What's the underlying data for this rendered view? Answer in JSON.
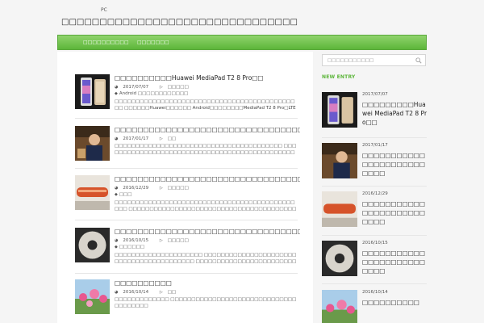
{
  "header": {
    "tagline": "PC",
    "site_title": "□□□□□□□□□□□□□□□□□□□□□□□□□□□□□□□"
  },
  "nav": {
    "items": [
      "□□□□□□□□□□",
      "□□□□□□□"
    ]
  },
  "posts": [
    {
      "title": "□□□□□□□□□□Huawei MediaPad T2 8 Pro□□",
      "date": "2017/07/07",
      "category": "□□□□□",
      "tags": "Android □□□□□□□□□□□□",
      "excerpt": "□□□□□□□□□□□□□□□□□□□□□□□□□□□□□□□□□□□□□□□□□□□□□ □□□□□□Huawei□□□□□□ Android□□□□□□□□MediaPad T2 8 Pro□LTE□□ ..."
    },
    {
      "title": "□□□□□□□□□□□□□□□□□□□□□□□□□□□□□□□□□",
      "date": "2017/01/17",
      "category": "□□",
      "tags": "",
      "excerpt": "□□□□□□□□□□□□□□□□□□□□□□□□□□□□□□□□□□□□□□□□ □□□□□□□□□□□□□□□□□□□□□□□□□□□□□□□□□□□□□□□□□□□□□□□□□□□□ ..."
    },
    {
      "title": "□□□□□□□□□□□□□□□□□□□□□□□□□□□□□□□□□",
      "date": "2016/12/29",
      "category": "□□□□□",
      "tags": "□□□",
      "excerpt": "□□□□□□□□□□□□□□□□□□□□□□□□□□□□□□□□□□□□□□□□□□□□□□ □□□□□□□□□□□□□□□□□□□□□□□□□□□□□□□□□□□□□□□□□□□□□□□□□ □ ..."
    },
    {
      "title": "□□□□□□□□□□□□□□□□□□□□□□□□□□□□□□□□□",
      "date": "2016/10/15",
      "category": "□□□□□",
      "tags": "□□□□□□",
      "excerpt": "□□□□□□□□□□□□□□□□□□□□□ □□□□□□□□□□□□□□□□□□□□□□□□□□□□□□□□□□□□□□□□□ □□□□□□□□□□□□□□□□□□□□□□□□□□□□□□□□□□□□□□ ..."
    },
    {
      "title": "□□□□□□□□□□",
      "date": "2016/10/14",
      "category": "□□",
      "tags": "",
      "excerpt": "□□□□□□□□□□□□□ □□□□□□□□□□□□□□□□□□□□□□□□□□□□□□□□□□□□□□"
    }
  ],
  "sidebar": {
    "search_placeholder": "□□□□□□□□□□□",
    "heading": "NEW ENTRY",
    "entries": [
      {
        "date": "2017/07/07",
        "title": "□□□□□□□□□Huawei MediaPad T2 8 Pro□□"
      },
      {
        "date": "2017/01/17",
        "title": "□□□□□□□□□□□□□□□□□□□□□□□□□□"
      },
      {
        "date": "2016/12/29",
        "title": "□□□□□□□□□□□□□□□□□□□□□□□□□□"
      },
      {
        "date": "2016/10/15",
        "title": "□□□□□□□□□□□□□□□□□□□□□□□□□□"
      },
      {
        "date": "2016/10/14",
        "title": "□□□□□□□□□□"
      }
    ]
  },
  "colors": {
    "accent": "#5cb63a",
    "nav_top": "#8fd36c",
    "nav_bottom": "#5cb63a"
  },
  "icons": {
    "calendar": "calendar-icon",
    "folder": "folder-icon",
    "tag": "tag-icon",
    "search": "search-icon"
  }
}
